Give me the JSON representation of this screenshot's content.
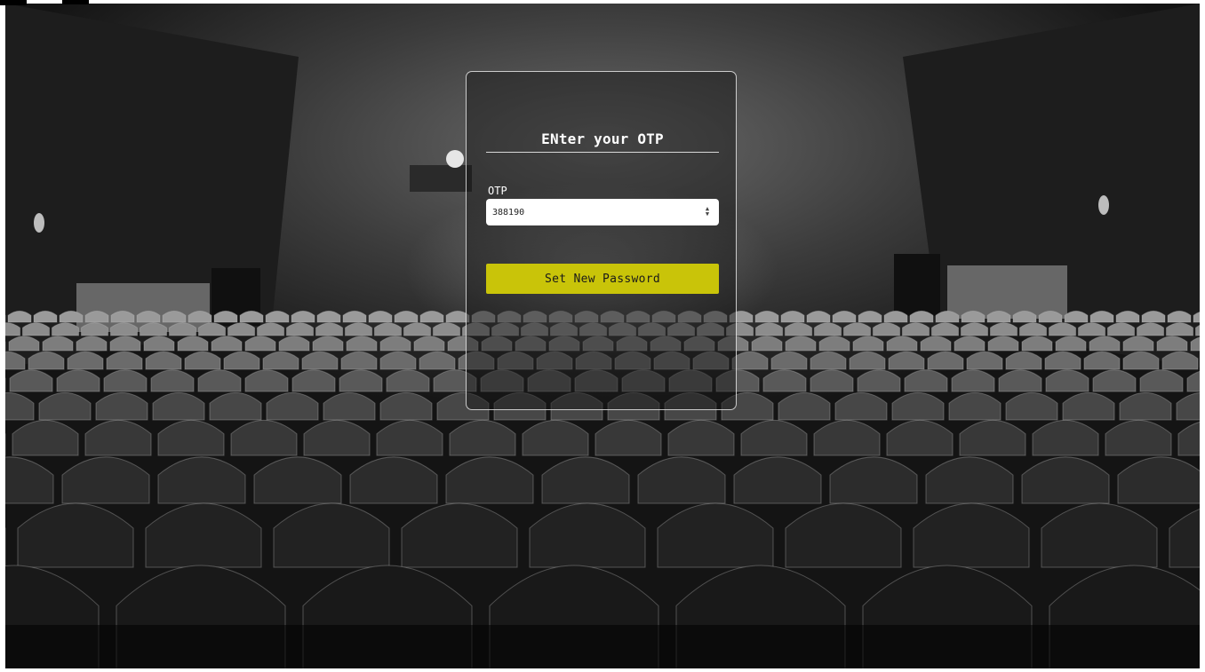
{
  "form": {
    "title": "ENter your OTP",
    "otp_label": "OTP",
    "otp_value": "388190",
    "submit_label": "Set New Password"
  },
  "colors": {
    "button": "#c9c409",
    "panel_border": "#ffffff",
    "text": "#ffffff"
  },
  "icons": {
    "spinner": "number-spinner-icon"
  }
}
